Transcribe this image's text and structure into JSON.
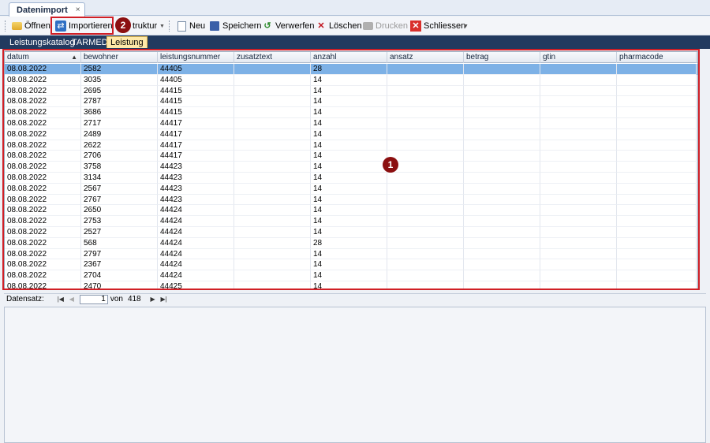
{
  "document_tab": {
    "title": "Datenimport",
    "close": "×"
  },
  "toolbar": {
    "open_label": "Öffnen",
    "import_label": "Importieren",
    "struktur_label": "truktur",
    "new_label": "Neu",
    "save_label": "Speichern",
    "discard_label": "Verwerfen",
    "delete_label": "Löschen",
    "print_label": "Drucken",
    "close_label": "Schliessen"
  },
  "subtabs": [
    "Leistungskatalog",
    "TARMED",
    "Leistung"
  ],
  "grid": {
    "columns": [
      "datum",
      "bewohner",
      "leistungsnummer",
      "zusatztext",
      "anzahl",
      "ansatz",
      "betrag",
      "gtin",
      "pharmacode"
    ],
    "rows": [
      [
        "08.08.2022",
        "2582",
        "44405",
        "",
        "28",
        "",
        "",
        "",
        ""
      ],
      [
        "08.08.2022",
        "3035",
        "44405",
        "",
        "14",
        "",
        "",
        "",
        ""
      ],
      [
        "08.08.2022",
        "2695",
        "44415",
        "",
        "14",
        "",
        "",
        "",
        ""
      ],
      [
        "08.08.2022",
        "2787",
        "44415",
        "",
        "14",
        "",
        "",
        "",
        ""
      ],
      [
        "08.08.2022",
        "3686",
        "44415",
        "",
        "14",
        "",
        "",
        "",
        ""
      ],
      [
        "08.08.2022",
        "2717",
        "44417",
        "",
        "14",
        "",
        "",
        "",
        ""
      ],
      [
        "08.08.2022",
        "2489",
        "44417",
        "",
        "14",
        "",
        "",
        "",
        ""
      ],
      [
        "08.08.2022",
        "2622",
        "44417",
        "",
        "14",
        "",
        "",
        "",
        ""
      ],
      [
        "08.08.2022",
        "2706",
        "44417",
        "",
        "14",
        "",
        "",
        "",
        ""
      ],
      [
        "08.08.2022",
        "3758",
        "44423",
        "",
        "14",
        "",
        "",
        "",
        ""
      ],
      [
        "08.08.2022",
        "3134",
        "44423",
        "",
        "14",
        "",
        "",
        "",
        ""
      ],
      [
        "08.08.2022",
        "2567",
        "44423",
        "",
        "14",
        "",
        "",
        "",
        ""
      ],
      [
        "08.08.2022",
        "2767",
        "44423",
        "",
        "14",
        "",
        "",
        "",
        ""
      ],
      [
        "08.08.2022",
        "2650",
        "44424",
        "",
        "14",
        "",
        "",
        "",
        ""
      ],
      [
        "08.08.2022",
        "2753",
        "44424",
        "",
        "14",
        "",
        "",
        "",
        ""
      ],
      [
        "08.08.2022",
        "2527",
        "44424",
        "",
        "14",
        "",
        "",
        "",
        ""
      ],
      [
        "08.08.2022",
        "568",
        "44424",
        "",
        "28",
        "",
        "",
        "",
        ""
      ],
      [
        "08.08.2022",
        "2797",
        "44424",
        "",
        "14",
        "",
        "",
        "",
        ""
      ],
      [
        "08.08.2022",
        "2367",
        "44424",
        "",
        "14",
        "",
        "",
        "",
        ""
      ],
      [
        "08.08.2022",
        "2704",
        "44424",
        "",
        "14",
        "",
        "",
        "",
        ""
      ],
      [
        "08.08.2022",
        "2470",
        "44425",
        "",
        "14",
        "",
        "",
        "",
        ""
      ]
    ]
  },
  "navigator": {
    "label": "Datensatz:",
    "current": "1",
    "of": "von",
    "total": "418"
  },
  "callouts": {
    "grid": "1",
    "import": "2"
  },
  "colors": {
    "selection": "#7db1e6",
    "frame": "#d01f26",
    "badge": "#8b0f10",
    "tabstrip": "#223a5f"
  }
}
